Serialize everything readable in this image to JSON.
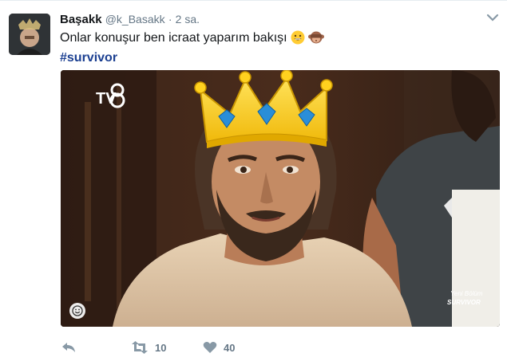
{
  "tweet": {
    "author_name": "Başakk",
    "author_handle": "@k_Basakk",
    "separator": "·",
    "time": "2 sa.",
    "text": "Onlar konuşur ben icraat yaparım bakışı",
    "emojis": [
      "grinning-face",
      "see-no-evil-monkey"
    ],
    "hashtag": "#survivor"
  },
  "media": {
    "channel_logo": "tv8",
    "overlay_caption": [
      "Yeni Bölüm",
      "SURVIVOR"
    ]
  },
  "actions": {
    "reply_icon": "reply-icon",
    "retweet_icon": "retweet-icon",
    "retweet_count": "10",
    "like_icon": "heart-icon",
    "like_count": "40"
  },
  "colors": {
    "hashtag": "#1b3f91",
    "muted": "#657786",
    "crown_gold": "#f5c518"
  }
}
